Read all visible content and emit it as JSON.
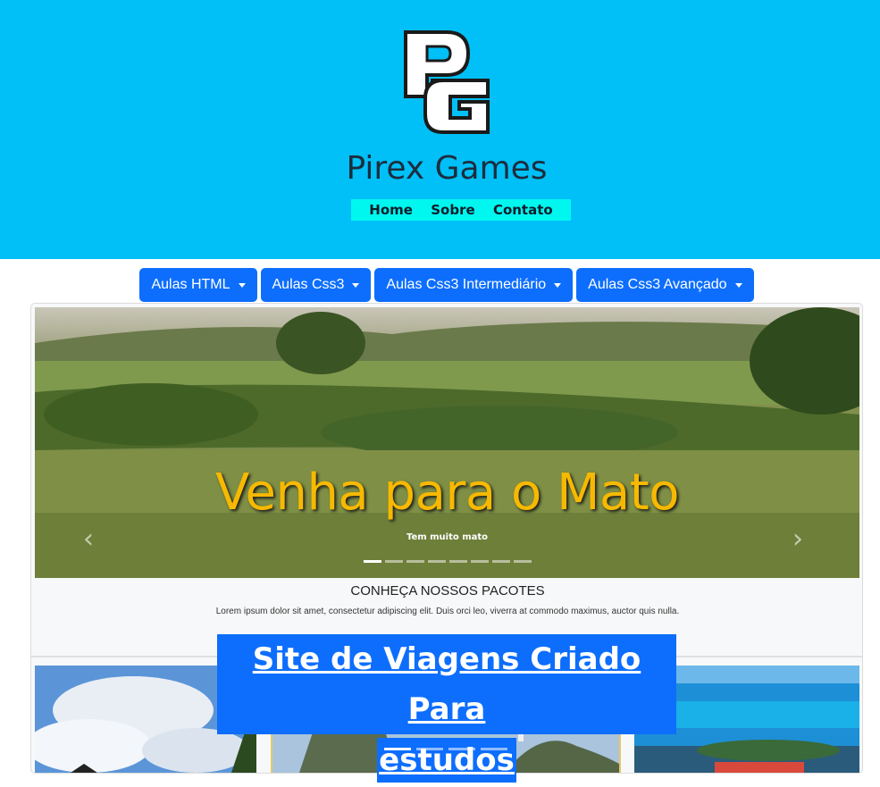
{
  "header": {
    "logo_text": "PG",
    "title": "Pirex Games",
    "nav": [
      {
        "label": "Home"
      },
      {
        "label": "Sobre"
      },
      {
        "label": "Contato"
      }
    ]
  },
  "dropdowns": [
    {
      "label": "Aulas HTML"
    },
    {
      "label": "Aulas Css3"
    },
    {
      "label": "Aulas Css3 Intermediário"
    },
    {
      "label": "Aulas Css3 Avançado"
    }
  ],
  "hero": {
    "caption": "Venha para o Mato",
    "subcaption": "Tem muito mato",
    "prev_icon": "chevron-left-icon",
    "next_icon": "chevron-right-icon",
    "slide_count": 8,
    "active_slide": 1
  },
  "packages": {
    "title": "CONHEÇA NOSSOS PACOTES",
    "text": "Lorem ipsum dolor sit amet, consectetur adipiscing elit. Duis orci leo, viverra at commodo maximus, auctor quis nulla."
  },
  "banner": {
    "line1": "Site de Viagens Criado Para",
    "line2": "estudos"
  },
  "colors": {
    "header_bg": "#00c0f7",
    "nav_bg": "#00f7f0",
    "button_bg": "#0d6efd",
    "caption": "#f7b900"
  }
}
